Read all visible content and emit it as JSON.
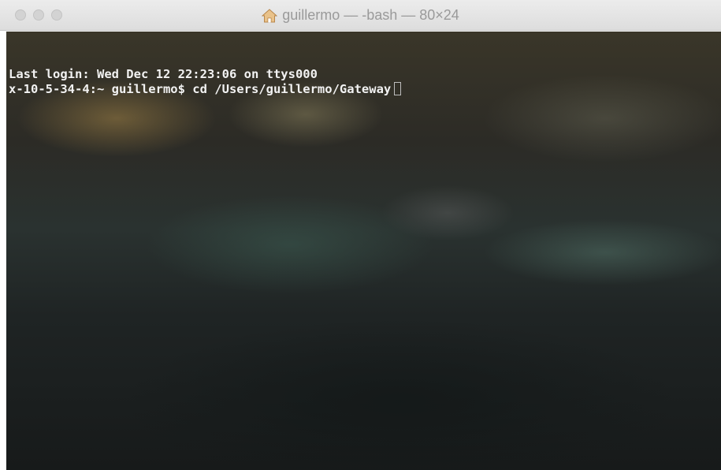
{
  "window": {
    "title": "guillermo — -bash — 80×24",
    "title_icon": "home-icon"
  },
  "terminal": {
    "lines": [
      "Last login: Wed Dec 12 22:23:06 on ttys000",
      "x-10-5-34-4:~ guillermo$ cd /Users/guillermo/Gateway"
    ],
    "text_color": "#f2f2f2",
    "cursor_icon": "cursor-block"
  }
}
